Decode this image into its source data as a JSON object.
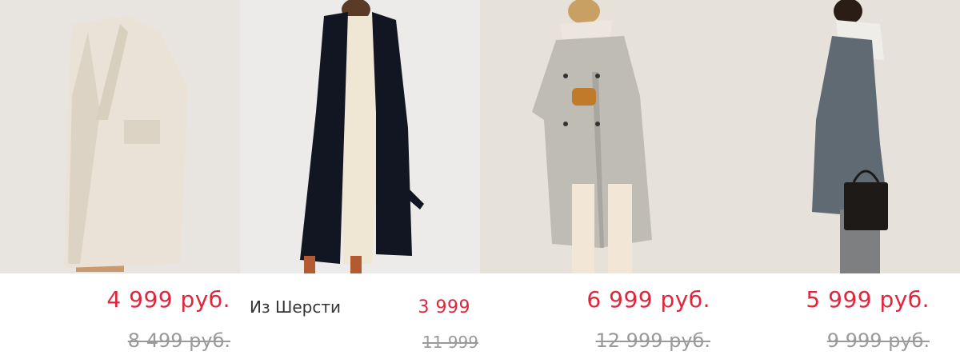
{
  "products": [
    {
      "name": "",
      "price_new": "4 999 руб.",
      "price_old": "8 499 руб.",
      "photo_bg": "#e8e4e0",
      "coat_color": "#eae2d6"
    },
    {
      "name": "Из Шерсти",
      "price_new": "3 999",
      "price_old": "11 999",
      "photo_bg": "#ecebe9",
      "coat_color": "#121522"
    },
    {
      "name": "",
      "price_new": "6 999 руб.",
      "price_old": "12 999 руб.",
      "photo_bg": "#e6e1d9",
      "coat_color": "#bfbcb4"
    },
    {
      "name": "",
      "price_new": "5 999 руб.",
      "price_old": "9 999 руб.",
      "photo_bg": "#e6e2db",
      "coat_color": "#5f6a73"
    }
  ],
  "colors": {
    "sale_price": "#e0263c",
    "old_price": "#9a9a9a"
  }
}
